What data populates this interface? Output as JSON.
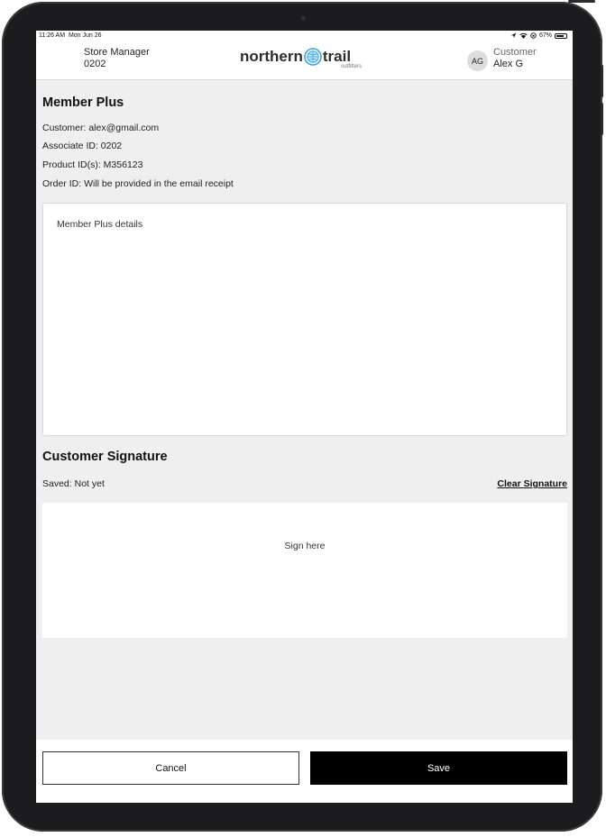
{
  "status_bar": {
    "time": "11:26 AM",
    "date": "Mon Jun 26",
    "battery": "67%"
  },
  "header": {
    "user_role": "Store Manager",
    "user_id": "0202",
    "logo": {
      "word1": "northern",
      "word2": "trail",
      "sub": "outfitters"
    },
    "avatar_initials": "AG",
    "customer_label": "Customer",
    "customer_name": "Alex G"
  },
  "member": {
    "title": "Member Plus",
    "customer": "Customer: alex@gmail.com",
    "associate": "Associate ID: 0202",
    "product": "Product ID(s): M356123",
    "order": "Order ID: Will be provided in the email receipt",
    "details": "Member Plus details"
  },
  "signature": {
    "title": "Customer Signature",
    "saved": "Saved: Not yet",
    "clear_label": "Clear Signature",
    "pad_hint": "Sign here"
  },
  "footer": {
    "cancel_label": "Cancel",
    "save_label": "Save"
  },
  "colors": {
    "background": "#efefef",
    "primary_button": "#000000",
    "logo_accent": "#3aa6dd"
  }
}
